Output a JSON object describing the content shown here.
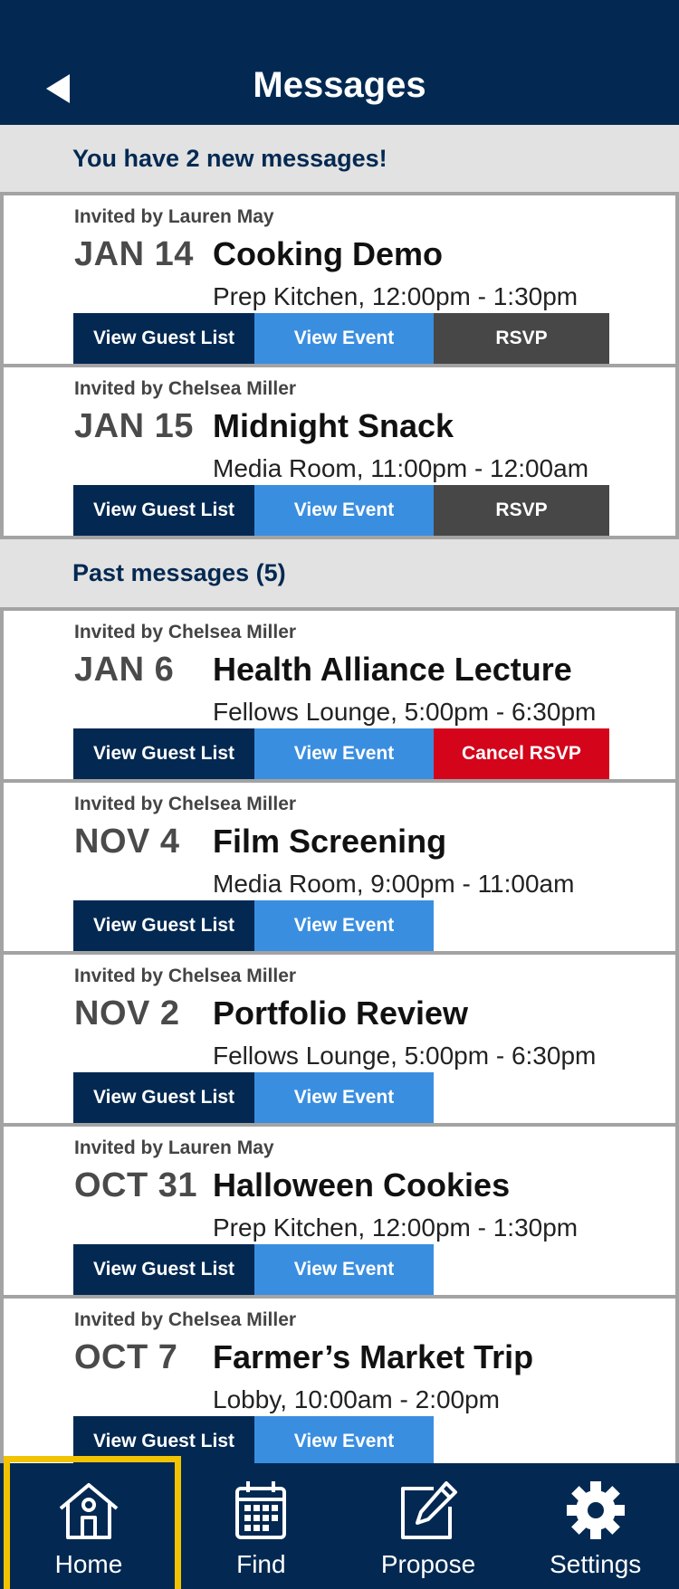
{
  "header": {
    "title": "Messages"
  },
  "new_section": {
    "label": "You have 2 new messages!"
  },
  "past_section": {
    "label": "Past messages (5)"
  },
  "buttons": {
    "guest": "View Guest List",
    "view": "View Event",
    "rsvp": "RSVP",
    "cancel": "Cancel RSVP"
  },
  "new_messages": [
    {
      "inviter": "Invited by Lauren May",
      "date": "JAN 14",
      "title": "Cooking Demo",
      "location": "Prep Kitchen, 12:00pm - 1:30pm",
      "action": "rsvp"
    },
    {
      "inviter": "Invited by Chelsea Miller",
      "date": "JAN 15",
      "title": "Midnight Snack",
      "location": "Media Room, 11:00pm - 12:00am",
      "action": "rsvp"
    }
  ],
  "past_messages": [
    {
      "inviter": "Invited by Chelsea Miller",
      "date": "JAN 6",
      "title": "Health Alliance Lecture",
      "location": "Fellows Lounge, 5:00pm - 6:30pm",
      "action": "cancel"
    },
    {
      "inviter": "Invited by Chelsea Miller",
      "date": "NOV 4",
      "title": "Film Screening",
      "location": "Media Room, 9:00pm - 11:00am",
      "action": "none"
    },
    {
      "inviter": "Invited by Chelsea Miller",
      "date": "NOV 2",
      "title": "Portfolio Review",
      "location": "Fellows Lounge, 5:00pm - 6:30pm",
      "action": "none"
    },
    {
      "inviter": "Invited by Lauren May",
      "date": "OCT 31",
      "title": "Halloween Cookies",
      "location": "Prep Kitchen, 12:00pm - 1:30pm",
      "action": "none"
    },
    {
      "inviter": "Invited by Chelsea Miller",
      "date": "OCT 7",
      "title": "Farmer’s Market Trip",
      "location": "Lobby, 10:00am - 2:00pm",
      "action": "none"
    }
  ],
  "tabbar": {
    "items": [
      {
        "label": "Home",
        "icon": "home-icon",
        "active": true
      },
      {
        "label": "Find",
        "icon": "calendar-icon",
        "active": false
      },
      {
        "label": "Propose",
        "icon": "edit-icon",
        "active": false
      },
      {
        "label": "Settings",
        "icon": "gear-icon",
        "active": false
      }
    ]
  },
  "colors": {
    "navy": "#032952",
    "blue": "#3a8ee0",
    "gray_button": "#474747",
    "red": "#d4051a",
    "highlight": "#f2c300"
  }
}
